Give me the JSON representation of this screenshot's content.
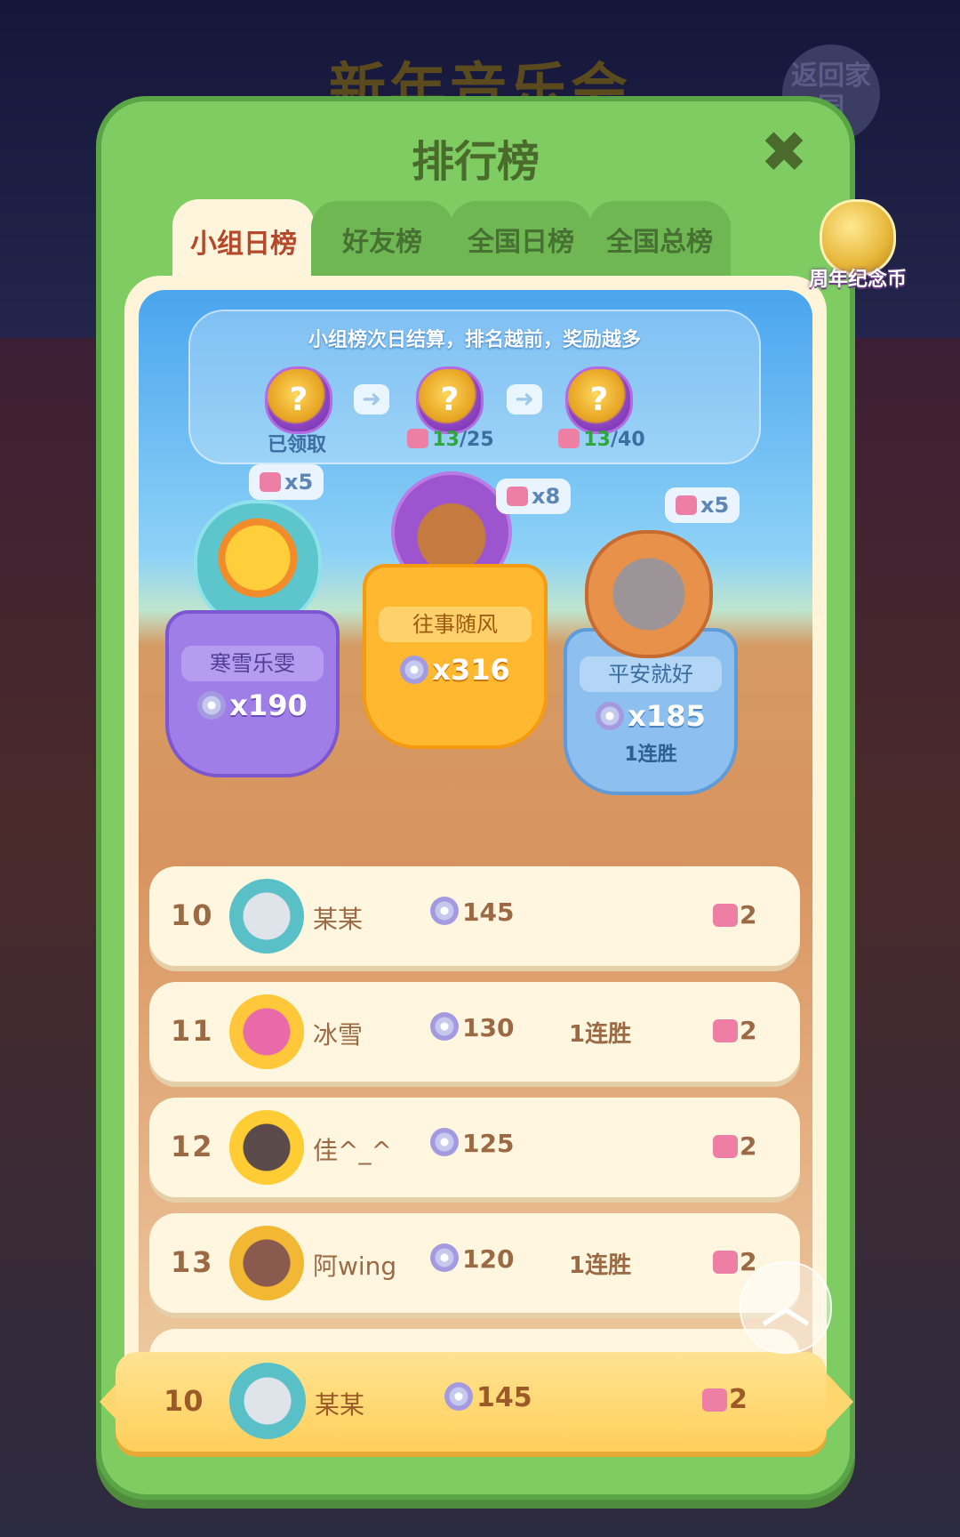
{
  "background": {
    "title": "新年音乐会",
    "return_label": "返回家园"
  },
  "panel": {
    "title": "排行榜",
    "close": "✖"
  },
  "tabs": [
    {
      "label": "小组日榜",
      "active": true
    },
    {
      "label": "好友榜",
      "active": false
    },
    {
      "label": "全国日榜",
      "active": false
    },
    {
      "label": "全国总榜",
      "active": false
    }
  ],
  "coin_badge": {
    "label": "周年纪念币"
  },
  "rewards": {
    "title": "小组榜次日结算，排名越前，奖励越多",
    "chests": [
      {
        "icon": "?",
        "status": "已领取"
      },
      {
        "icon": "?",
        "current": "13",
        "total": "/25"
      },
      {
        "icon": "?",
        "current": "13",
        "total": "/40"
      }
    ]
  },
  "podium": {
    "first": {
      "name": "往事随风",
      "score": "x316",
      "reward": "x8"
    },
    "second": {
      "name": "寒雪乐雯",
      "score": "x190",
      "reward": "x5"
    },
    "third": {
      "name": "平安就好",
      "score": "x185",
      "streak": "1连胜",
      "reward": "x5"
    }
  },
  "rows": [
    {
      "rank": "10",
      "name": "某某",
      "score": "145",
      "streak": "",
      "reward": "2"
    },
    {
      "rank": "11",
      "name": "冰雪",
      "score": "130",
      "streak": "1连胜",
      "reward": "2"
    },
    {
      "rank": "12",
      "name": "佳^_^",
      "score": "125",
      "streak": "",
      "reward": "2"
    },
    {
      "rank": "13",
      "name": "阿wing",
      "score": "120",
      "streak": "1连胜",
      "reward": "2"
    }
  ],
  "me": {
    "rank": "10",
    "name": "某某",
    "score": "145",
    "reward": "2"
  },
  "colors": {
    "panel_green": "#7fcc63",
    "active_tab": "#fff4dc",
    "me_row": "#ffcf5b"
  },
  "icons": {
    "close": "close-icon",
    "scroll_up": "chevron-up-icon",
    "disc": "disc-icon",
    "piece": "puzzle-piece-icon"
  }
}
